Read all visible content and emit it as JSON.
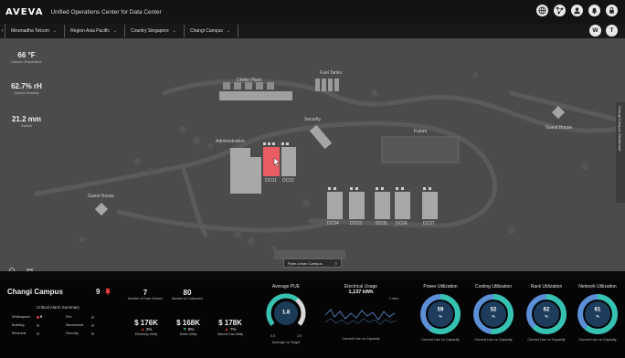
{
  "header": {
    "logo": "AVEVA",
    "title": "Unified Operations Center for Data Center",
    "icons": [
      "globe-icon",
      "network-icon",
      "user-icon",
      "bell-icon",
      "lock-icon"
    ]
  },
  "breadcrumb": [
    {
      "label": "Mesmadha Telcom"
    },
    {
      "label": "Region Asia Pacific"
    },
    {
      "label": "Country Singapore"
    },
    {
      "label": "Changi Campus"
    }
  ],
  "user_badges": [
    "W",
    "T"
  ],
  "weather": [
    {
      "value": "66 °F",
      "label": "Outdoor Temperature"
    },
    {
      "value": "62.7% rH",
      "label": "Outdoor Humidity"
    },
    {
      "value": "21.2 mm",
      "label": "Rainfall"
    }
  ],
  "map": {
    "labels": {
      "chiller": "Chiller Plant",
      "fuel": "Fuel Tanks",
      "security": "Security",
      "admin": "Administration",
      "future": "Future",
      "guest_right": "Guest House",
      "guest_left": "Guest House",
      "dc001": "DC01",
      "dc002": "DC02",
      "dc004": "DC04",
      "dc003": "DC03",
      "dc005": "DC05",
      "dc006": "DC06",
      "dc007": "DC07"
    },
    "side_tab": "Changi Campus Dashboard",
    "bottom_tab": "Ppeh Lehan Campus",
    "bottom_tab_icon": "≡",
    "highlight_color": "#e85c62"
  },
  "campus": {
    "name": "Changi Campus",
    "alarm_count": "9",
    "alarm_summary_title": "Critical Alarm Summary",
    "alarms": [
      {
        "label": "Whitespace",
        "count": "9",
        "active": true
      },
      {
        "label": "Building",
        "count": "",
        "active": false
      },
      {
        "label": "Electrical",
        "count": "",
        "active": false
      },
      {
        "label": "Fire",
        "count": "",
        "active": false
      },
      {
        "label": "Mechanical",
        "count": "",
        "active": false
      },
      {
        "label": "Security",
        "count": "",
        "active": false
      }
    ],
    "counts": [
      {
        "value": "7",
        "label": "Number of Data Centers"
      },
      {
        "value": "80",
        "label": "Number of Customers"
      }
    ],
    "utilities": [
      {
        "value": "$ 176K",
        "delta": "3%",
        "direction": "up",
        "label": "Electricity Utility"
      },
      {
        "value": "$ 168K",
        "delta": "8%",
        "direction": "down",
        "label": "Water Utility"
      },
      {
        "value": "$ 178K",
        "delta": "7%",
        "direction": "up",
        "label": "Natural Gas Utility"
      }
    ]
  },
  "pue": {
    "title": "Average PUE",
    "value": "1.8",
    "min": "0.5",
    "max": "2.5",
    "subtitle": "Average vs Target",
    "fraction": 0.65
  },
  "electrical": {
    "title": "Electrical Usage",
    "value": "1,137 kWh",
    "legend": "1 mins",
    "subtitle": "Current Use vs Capacity"
  },
  "utilization": [
    {
      "title": "Power Utilization",
      "value": "59",
      "unit": "%",
      "fraction": 0.59,
      "subtitle": "Current Use vs Capacity"
    },
    {
      "title": "Cooling Utilization",
      "value": "52",
      "unit": "%",
      "fraction": 0.52,
      "subtitle": "Current Use vs Capacity"
    },
    {
      "title": "Rack Utilization",
      "value": "62",
      "unit": "%",
      "fraction": 0.62,
      "subtitle": "Current Use vs Capacity"
    },
    {
      "title": "Network Utilization",
      "value": "61",
      "unit": "%",
      "fraction": 0.61,
      "subtitle": "Current Use vs Capacity"
    }
  ],
  "colors": {
    "accent_teal": "#35c2b1",
    "accent_blue": "#5b8fd6",
    "alarm_red": "#e23b3b"
  }
}
